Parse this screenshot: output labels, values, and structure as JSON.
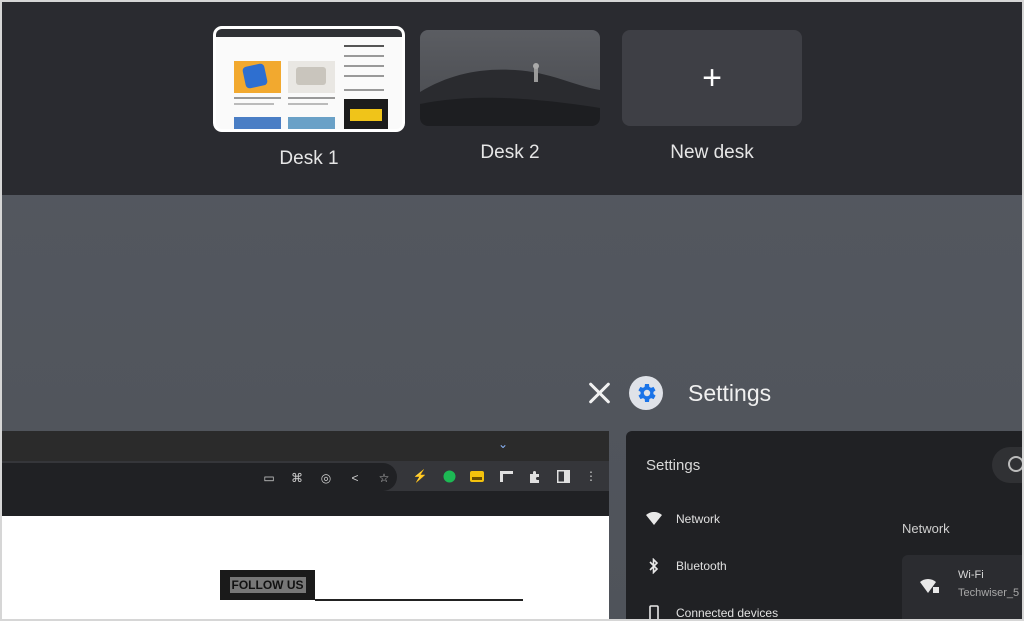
{
  "desks": [
    {
      "label": "Desk 1"
    },
    {
      "label": "Desk 2"
    },
    {
      "label": "New desk"
    }
  ],
  "new_desk_symbol": "+",
  "window": {
    "title": "Settings",
    "close_icon": "close-icon",
    "app_icon": "gear-icon"
  },
  "browser": {
    "follow_label": "FOLLOW US"
  },
  "settings": {
    "heading": "Settings",
    "nav": [
      {
        "label": "Network",
        "icon": "wifi-icon"
      },
      {
        "label": "Bluetooth",
        "icon": "bluetooth-icon"
      },
      {
        "label": "Connected devices",
        "icon": "phone-icon"
      }
    ],
    "section_title": "Network",
    "wifi": {
      "title": "Wi-Fi",
      "network": "Techwiser_5"
    }
  },
  "colors": {
    "shelf": "#2a2b30",
    "background": "#53575e",
    "accent": "#8ab4f8"
  }
}
